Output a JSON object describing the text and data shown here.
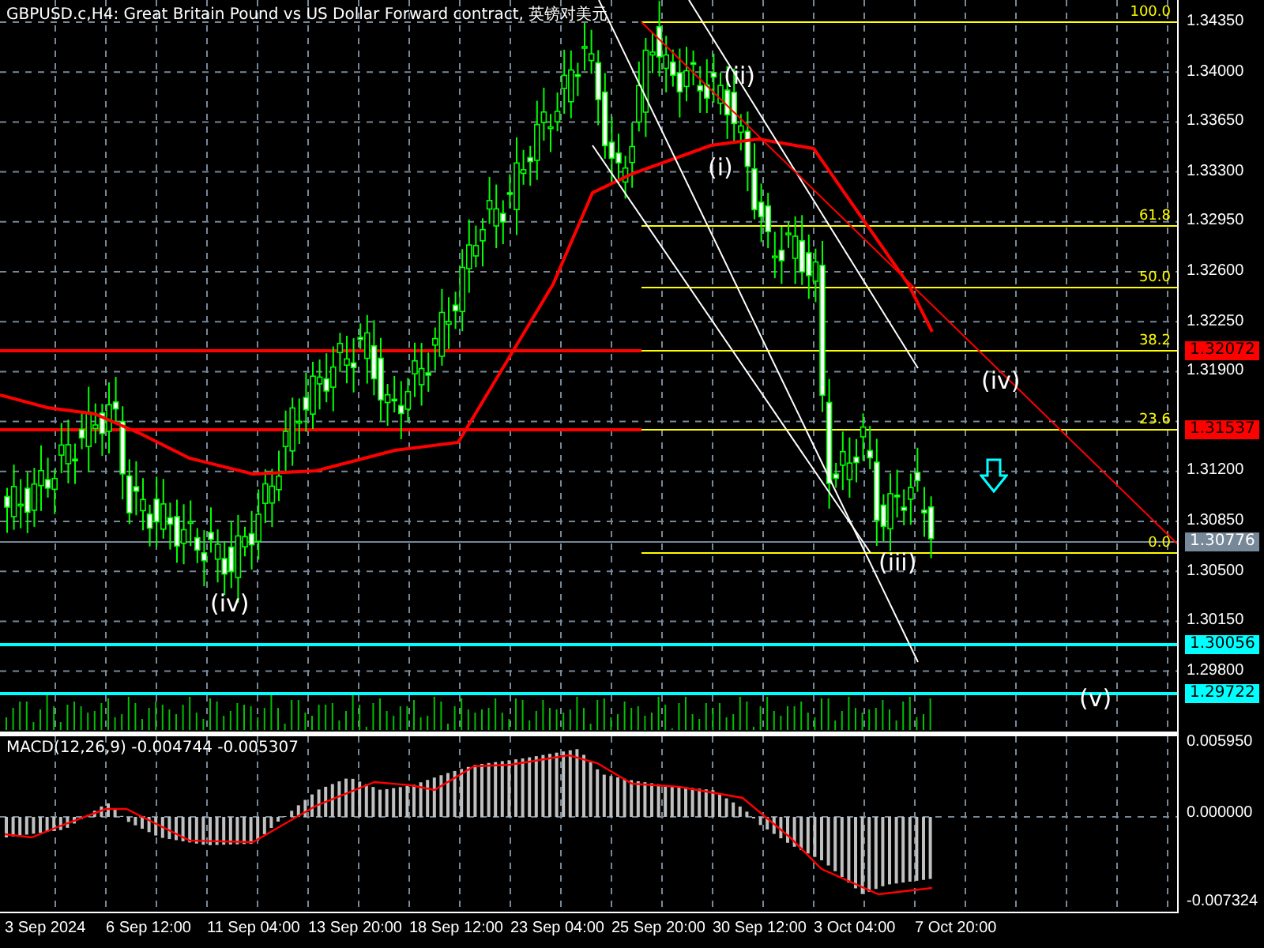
{
  "chart": {
    "title": "GBPUSD.c,H4:  Great Britain Pound vs US Dollar Forward contract, 英镑对美元",
    "price_axis": [
      "1.34350",
      "1.34000",
      "1.33650",
      "1.33300",
      "1.32950",
      "1.32600",
      "1.32250",
      "1.31900",
      "1.31200",
      "1.30850",
      "1.30500",
      "1.30150",
      "1.29800"
    ],
    "price_tags": [
      {
        "value": "1.32072",
        "color": "#ff0000"
      },
      {
        "value": "1.31537",
        "color": "#ff0000"
      },
      {
        "value": "1.30776",
        "color": "#778899"
      },
      {
        "value": "1.30056",
        "color": "#00ffff"
      },
      {
        "value": "1.29722",
        "color": "#00ffff"
      }
    ],
    "fib_levels": [
      "100.0",
      "61.8",
      "50.0",
      "38.2",
      "23.6",
      "0.0"
    ],
    "wave_labels": [
      "(ii)",
      "(i)",
      "(iv)",
      "(iii)",
      "(iv)",
      "(v)"
    ]
  },
  "macd": {
    "title": "MACD(12,26,9) -0.004744 -0.005307",
    "axis": [
      "0.005950",
      "0.000000",
      "-0.007324"
    ]
  },
  "time_axis": [
    "3 Sep 2024",
    "6 Sep 12:00",
    "11 Sep 04:00",
    "13 Sep 20:00",
    "18 Sep 12:00",
    "23 Sep 04:00",
    "25 Sep 20:00",
    "30 Sep 12:00",
    "3 Oct 04:00",
    "7 Oct 20:00"
  ]
}
